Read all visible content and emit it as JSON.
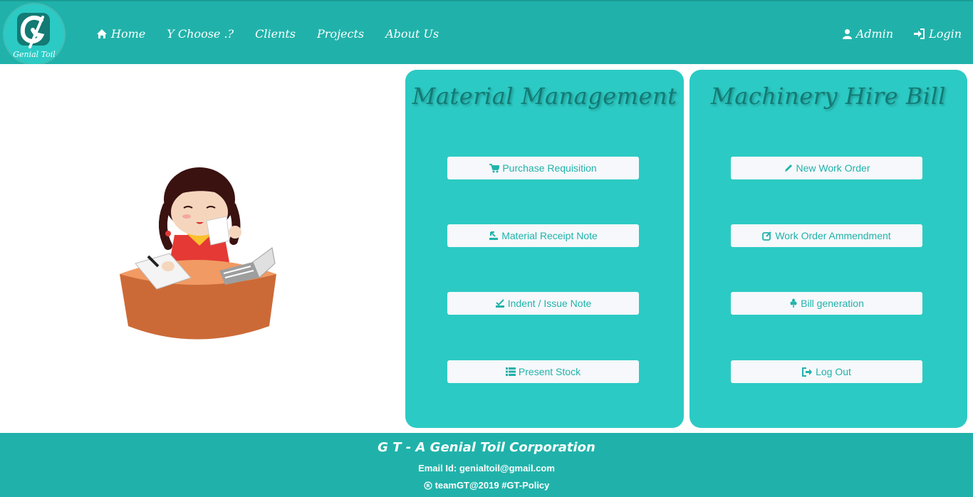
{
  "brand": {
    "logo_text": "Genial Toil",
    "logo_letter": "G"
  },
  "nav": {
    "left": [
      {
        "label": "Home",
        "icon": "home-icon"
      },
      {
        "label": "Y Choose .?"
      },
      {
        "label": "Clients"
      },
      {
        "label": "Projects"
      },
      {
        "label": "About Us"
      }
    ],
    "right": [
      {
        "label": "Admin",
        "icon": "user-icon"
      },
      {
        "label": "Login",
        "icon": "login-icon"
      }
    ]
  },
  "panels": {
    "material": {
      "title": "Material Management",
      "buttons": [
        {
          "label": "Purchase Requisition",
          "icon": "cart-icon"
        },
        {
          "label": "Material Receipt Note",
          "icon": "receipt-icon"
        },
        {
          "label": "Indent / Issue Note",
          "icon": "issue-icon"
        },
        {
          "label": "Present Stock",
          "icon": "list-icon"
        }
      ]
    },
    "machinery": {
      "title": "Machinery Hire Bill",
      "buttons": [
        {
          "label": "New Work Order",
          "icon": "pencil-icon"
        },
        {
          "label": "Work Order Ammendment",
          "icon": "edit-icon"
        },
        {
          "label": "Bill generation",
          "icon": "grain-icon"
        },
        {
          "label": "Log Out",
          "icon": "logout-icon"
        }
      ]
    }
  },
  "footer": {
    "title": "G T - A Genial Toil Corporation",
    "email": "Email Id: genialtoil@gmail.com",
    "copyright": "teamGT@2019 #GT-Policy"
  },
  "colors": {
    "primary": "#20b2aa",
    "panel": "#2ccac4",
    "title": "#137a74",
    "button_bg": "#f6f8fb"
  }
}
